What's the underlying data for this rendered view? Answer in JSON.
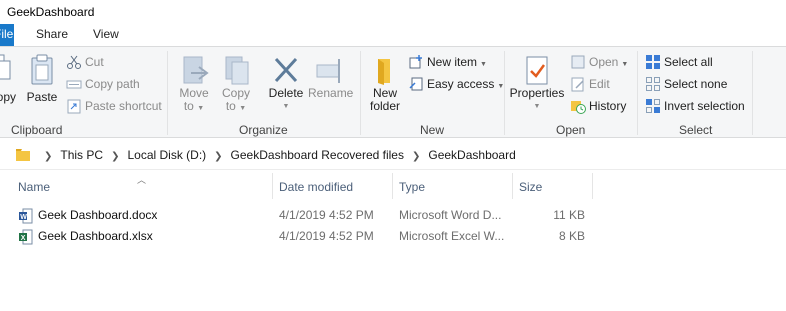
{
  "window": {
    "title": "GeekDashboard"
  },
  "tabs": {
    "file": "File",
    "share": "Share",
    "view": "View"
  },
  "ribbon": {
    "clipboard": {
      "label": "Clipboard",
      "copy": "Copy",
      "paste": "Paste",
      "cut": "Cut",
      "copy_path": "Copy path",
      "paste_shortcut": "Paste shortcut"
    },
    "organize": {
      "label": "Organize",
      "move_to": [
        "Move",
        "to"
      ],
      "copy_to": [
        "Copy",
        "to"
      ],
      "delete": "Delete",
      "rename": "Rename"
    },
    "new": {
      "label": "New",
      "new_folder": [
        "New",
        "folder"
      ],
      "new_item": "New item",
      "easy_access": "Easy access"
    },
    "open": {
      "label": "Open",
      "properties": "Properties",
      "open": "Open",
      "edit": "Edit",
      "history": "History"
    },
    "select": {
      "label": "Select",
      "select_all": "Select all",
      "select_none": "Select none",
      "invert_selection": "Invert selection"
    }
  },
  "address": {
    "crumbs": [
      "This PC",
      "Local Disk (D:)",
      "GeekDashboard Recovered files",
      "GeekDashboard"
    ]
  },
  "columns": {
    "name": "Name",
    "date": "Date modified",
    "type": "Type",
    "size": "Size"
  },
  "files": [
    {
      "name": "Geek Dashboard.docx",
      "date": "4/1/2019 4:52 PM",
      "type": "Microsoft Word D...",
      "size": "11 KB",
      "icon": "word-doc-icon"
    },
    {
      "name": "Geek Dashboard.xlsx",
      "date": "4/1/2019 4:52 PM",
      "type": "Microsoft Excel W...",
      "size": "8 KB",
      "icon": "excel-sheet-icon"
    }
  ],
  "colors": {
    "file_tab": "#1979ca",
    "ribbon_bg": "#f5f6f7",
    "header_text": "#4c607a",
    "select_icon": "#3a7bd5"
  }
}
